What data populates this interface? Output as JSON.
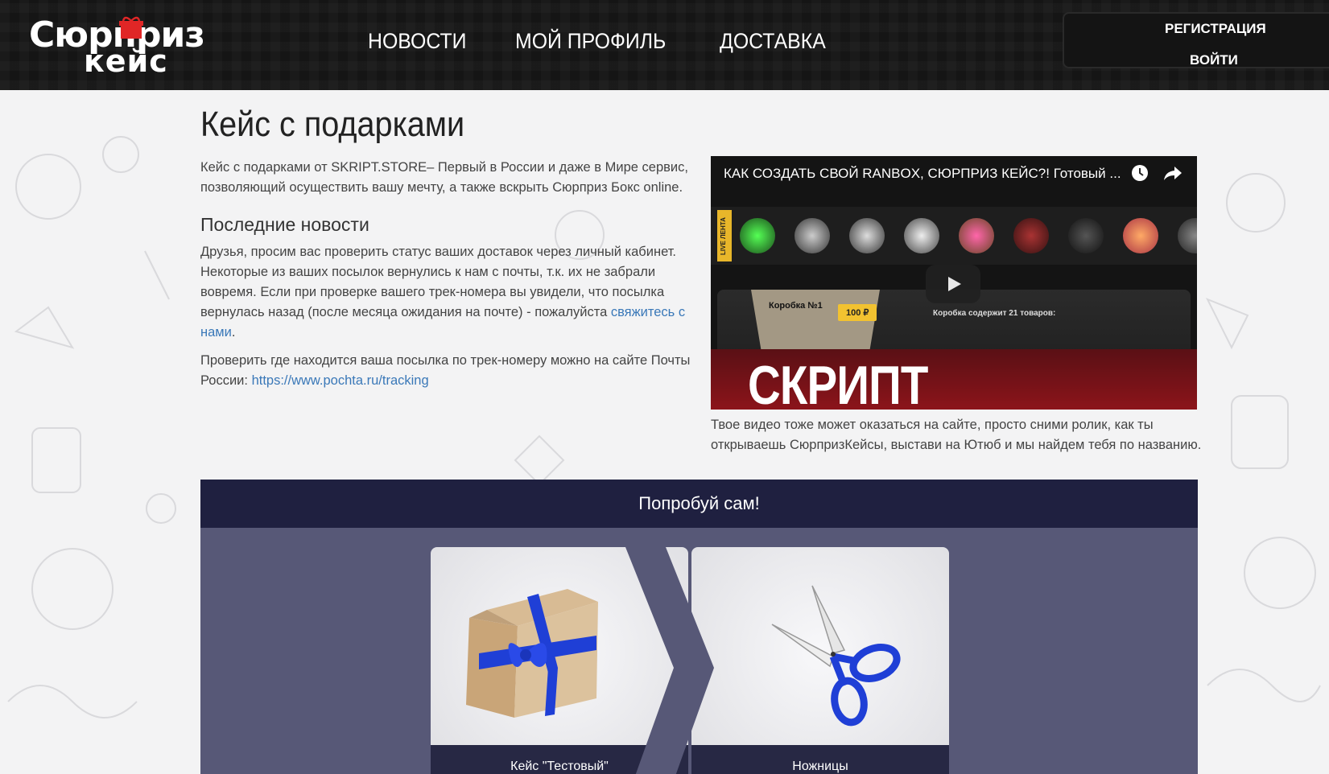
{
  "header": {
    "logo_line1": "Сюрприз",
    "logo_line2": "кейс",
    "nav": [
      "НОВОСТИ",
      "МОЙ ПРОФИЛЬ",
      "ДОСТАВКА"
    ],
    "auth": {
      "register": "РЕГИСТРАЦИЯ",
      "login": "ВОЙТИ"
    }
  },
  "main": {
    "title": "Кейс с подарками",
    "intro": "Кейс с подарками от SKRIPT.STORE– Первый в России и даже в Мире сервис, позволяющий осуществить вашу мечту, а также вскрыть Сюрприз Бокс online.",
    "news_title": "Последние новости",
    "news_p1_text": "Друзья, просим вас проверить статус ваших доставок через личный кабинет. Некоторые из ваших посылок вернулись к нам с почты, т.к. их не забрали вовремя. Если при проверке вашего трек-номера вы увидели, что посылка вернулась назад (после месяца ожидания на почте) - пожалуйста ",
    "news_p1_link": "свяжитесь с нами",
    "news_p1_end": ".",
    "news_p2_text": "Проверить где находится ваша посылка по трек-номеру можно на сайте Почты России: ",
    "news_p2_link": "https://www.pochta.ru/tracking"
  },
  "video": {
    "title": "КАК СОЗДАТЬ СВОЙ RANBOX, СЮРПРИЗ КЕЙС?! Готовый ...",
    "strip_tag": "LIVE ЛЕНТА",
    "box_label": "Коробка №1",
    "price": "100 ₽",
    "contains": "Коробка содержит 21 товаров:",
    "banner": "СКРИПТ RANBOX",
    "caption": "Твое видео тоже может оказаться на сайте, просто сними ролик, как ты открываешь СюрпризКейсы, выстави на Ютюб и мы найдем тебя по названию."
  },
  "try": {
    "title": "Попробуй сам!",
    "cards": [
      {
        "name": "Кейс \"Тестовый\"",
        "icon": "gift-box"
      },
      {
        "name": "Ножницы",
        "icon": "scissors"
      }
    ]
  },
  "colors": {
    "header_bg": "#1a1a1a",
    "link": "#3a78b8",
    "try_bg": "#575877",
    "try_head_bg": "#1f2040",
    "ribbon": "#1f3fd6",
    "banner_red": "#8c141a"
  }
}
